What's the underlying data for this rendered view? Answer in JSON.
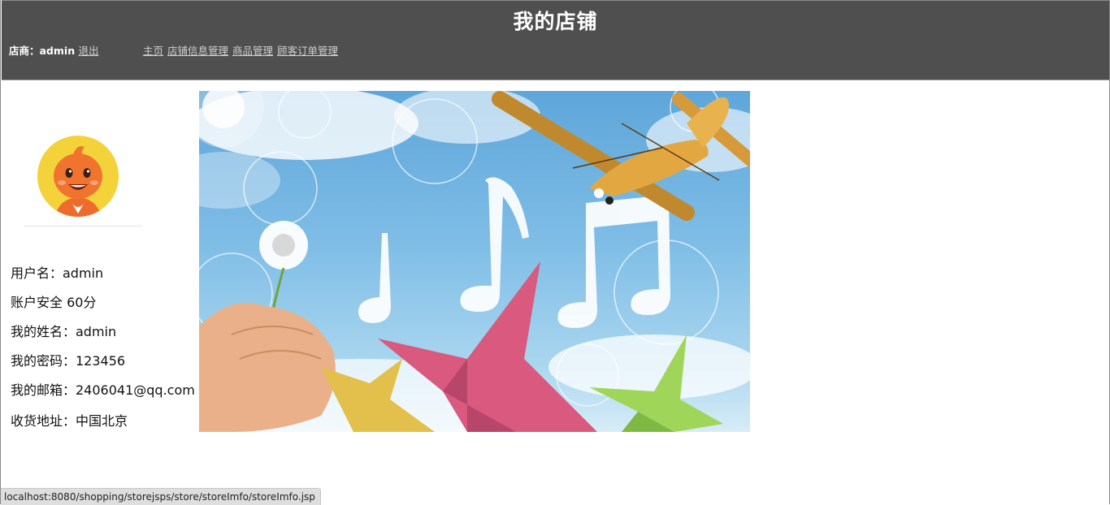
{
  "header": {
    "title": "我的店铺",
    "merchant_label": "店商：admin",
    "logout_label": "退出",
    "nav": [
      {
        "label": "主页"
      },
      {
        "label": "店铺信息管理"
      },
      {
        "label": "商品管理"
      },
      {
        "label": "顾客订单管理"
      }
    ]
  },
  "profile": {
    "username": "用户名：admin",
    "security": "账户安全 60分",
    "name": "我的姓名：admin",
    "password": "我的密码：123456",
    "email": "我的邮箱：2406041@qq.com",
    "address": "收货地址：中国北京"
  },
  "status_bar": {
    "url": "localhost:8080/shopping/storejsps/store/storeImfo/storeImfo.jsp"
  },
  "colors": {
    "header_bg": "#4f4f4f",
    "header_text": "#ffffff",
    "link": "#cfcfcf"
  }
}
